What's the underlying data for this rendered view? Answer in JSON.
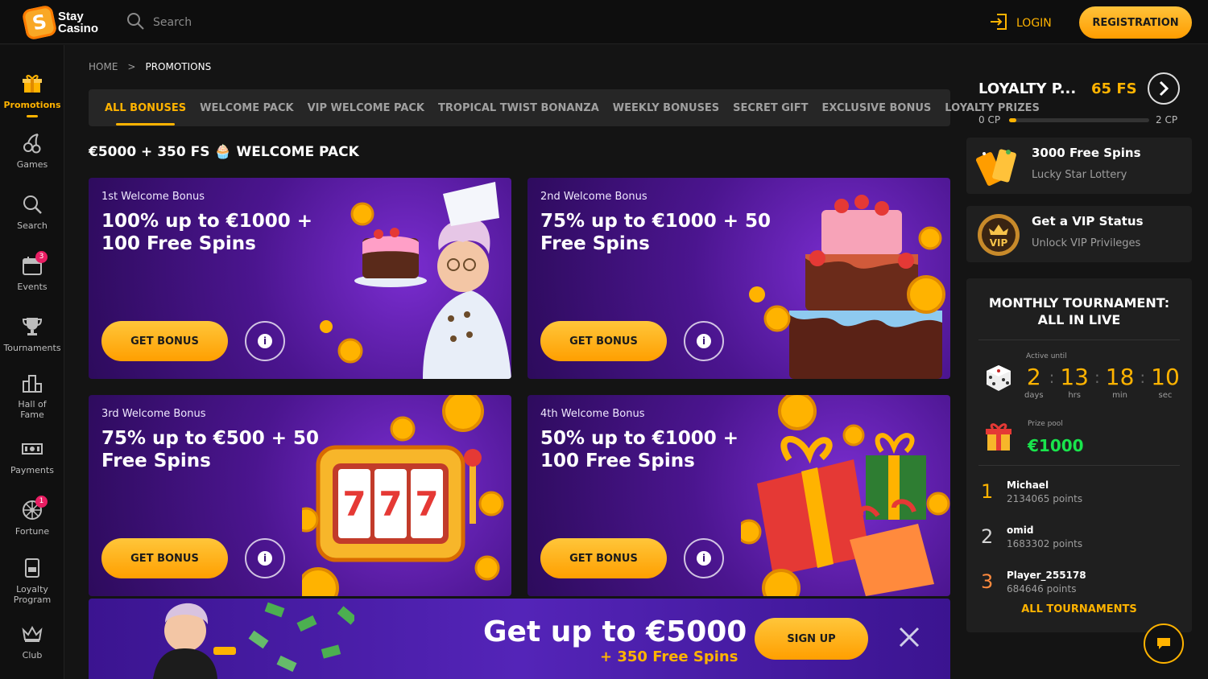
{
  "brand": {
    "line1": "Stay",
    "line2": "Casino",
    "mark": "S",
    "accent": "#ffb300"
  },
  "header": {
    "search_label": "Search",
    "login_label": "LOGIN",
    "registration_label": "REGISTRATION"
  },
  "sidebar": {
    "items": [
      {
        "label": "Promotions",
        "icon": "gift-icon"
      },
      {
        "label": "Games",
        "icon": "cherries-icon"
      },
      {
        "label": "Search",
        "icon": "search-icon"
      },
      {
        "label": "Events",
        "icon": "calendar-icon",
        "badge": "3"
      },
      {
        "label": "Tournaments",
        "icon": "trophy-icon"
      },
      {
        "label": "Hall of Fame",
        "icon": "podium-icon"
      },
      {
        "label": "Payments",
        "icon": "cash-icon"
      },
      {
        "label": "Fortune",
        "icon": "wheel-icon",
        "badge": "1"
      },
      {
        "label": "Loyalty Program",
        "icon": "vip-card-icon"
      },
      {
        "label": "Club",
        "icon": "crown-icon"
      }
    ]
  },
  "breadcrumb": {
    "home": "HOME",
    "sep": ">",
    "current": "PROMOTIONS"
  },
  "tabs": [
    "ALL BONUSES",
    "WELCOME PACK",
    "VIP WELCOME PACK",
    "TROPICAL TWIST BONANZA",
    "WEEKLY BONUSES",
    "SECRET GIFT",
    "EXCLUSIVE BONUS",
    "LOYALTY PRIZES"
  ],
  "section": {
    "title": "€5000 + 350 FS 🧁 WELCOME PACK"
  },
  "cards": [
    {
      "sub": "1st Welcome Bonus",
      "title": "100% up to €1000 + 100 Free Spins",
      "button": "GET BONUS",
      "info": "i"
    },
    {
      "sub": "2nd Welcome Bonus",
      "title": "75% up to €1000 + 50 Free Spins",
      "button": "GET BONUS",
      "info": "i"
    },
    {
      "sub": "3rd Welcome Bonus",
      "title": "75% up to €500 + 50 Free Spins",
      "button": "GET BONUS",
      "info": "i"
    },
    {
      "sub": "4th Welcome Bonus",
      "title": "50% up to €1000 + 100 Free Spins",
      "button": "GET BONUS",
      "info": "i"
    }
  ],
  "slot_digits": [
    "7",
    "7",
    "7"
  ],
  "banner": {
    "headline": "Get up to €5000",
    "subline": "+ 350 Free Spins",
    "button": "SIGN UP"
  },
  "loyalty": {
    "title": "LOYALTY P...",
    "free_spins": "65 FS",
    "cp_left": "0 CP",
    "cp_right": "2 CP",
    "progress": 0.05
  },
  "promos": [
    {
      "title": "3000 Free Spins",
      "sub": "Lucky Star Lottery",
      "icon": "lottery-ticket-icon"
    },
    {
      "title": "Get a VIP Status",
      "sub": "Unlock VIP Privileges",
      "icon": "vip-badge-icon",
      "badge_text": "VIP"
    }
  ],
  "tournament": {
    "title": "MONTHLY TOURNAMENT: ALL IN LIVE",
    "active_label": "Active until",
    "countdown": [
      {
        "n": "2",
        "u": "days"
      },
      {
        "n": "13",
        "u": "hrs"
      },
      {
        "n": "18",
        "u": "min"
      },
      {
        "n": "10",
        "u": "sec"
      }
    ],
    "pool_label": "Prize pool",
    "pool_value": "€1000",
    "leaders": [
      {
        "rank": "1",
        "name": "Michael",
        "points": "2134065 points"
      },
      {
        "rank": "2",
        "name": "omid",
        "points": "1683302 points"
      },
      {
        "rank": "3",
        "name": "Player_255178",
        "points": "684646 points"
      }
    ],
    "all_label": "ALL TOURNAMENTS"
  }
}
